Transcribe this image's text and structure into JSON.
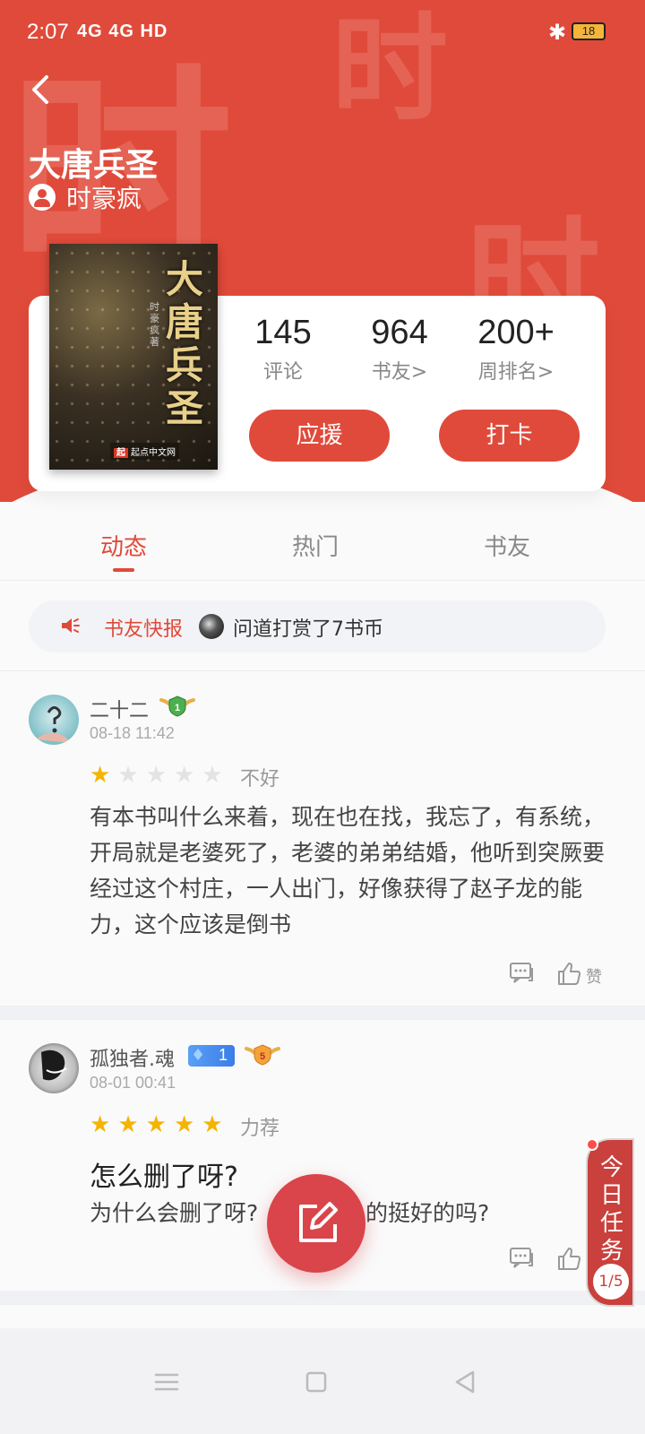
{
  "status_bar": {
    "time": "2:07",
    "network": "4G 4G HD",
    "battery": "18"
  },
  "header": {
    "title": "大唐兵圣",
    "author": "时豪疯",
    "watermark_char": "时",
    "accent_color": "#e04a3a"
  },
  "book": {
    "cover_title": "大唐兵圣",
    "cover_author": "时豪疯 著",
    "publisher": "起点中文网",
    "publisher_mark": "起"
  },
  "stats": [
    {
      "value": "145",
      "label": "评论"
    },
    {
      "value": "964",
      "label": "书友>"
    },
    {
      "value": "200+",
      "label": "周排名>"
    }
  ],
  "buttons": {
    "support": "应援",
    "checkin": "打卡"
  },
  "tabs": [
    {
      "label": "动态",
      "active": true
    },
    {
      "label": "热门",
      "active": false
    },
    {
      "label": "书友",
      "active": false
    }
  ],
  "news": {
    "label": "书友快报",
    "text": "问道打赏了7书币"
  },
  "posts": [
    {
      "user": "二十二",
      "level": "1",
      "date": "08-18 11:42",
      "rating": 1,
      "rating_text": "不好",
      "title": "",
      "body": "有本书叫什么来着，现在也在找，我忘了，有系统，开局就是老婆死了，老婆的弟弟结婚，他听到突厥要经过这个村庄，一人出门，好像获得了赵子龙的能力，这个应该是倒书",
      "like_label": "赞"
    },
    {
      "user": "孤独者.魂",
      "fan_level": "1",
      "level": "5",
      "date": "08-01 00:41",
      "rating": 5,
      "rating_text": "力荐",
      "title": "怎么删了呀?",
      "body_left": "为什么会删了呀?",
      "body_right": "的挺好的吗?"
    }
  ],
  "task": {
    "label": "今日任务",
    "progress": "1/5"
  },
  "icons": {
    "back": "back-arrow-icon",
    "edit": "edit-icon",
    "comment": "comment-icon",
    "like": "thumb-up-icon",
    "speaker": "speaker-icon"
  }
}
